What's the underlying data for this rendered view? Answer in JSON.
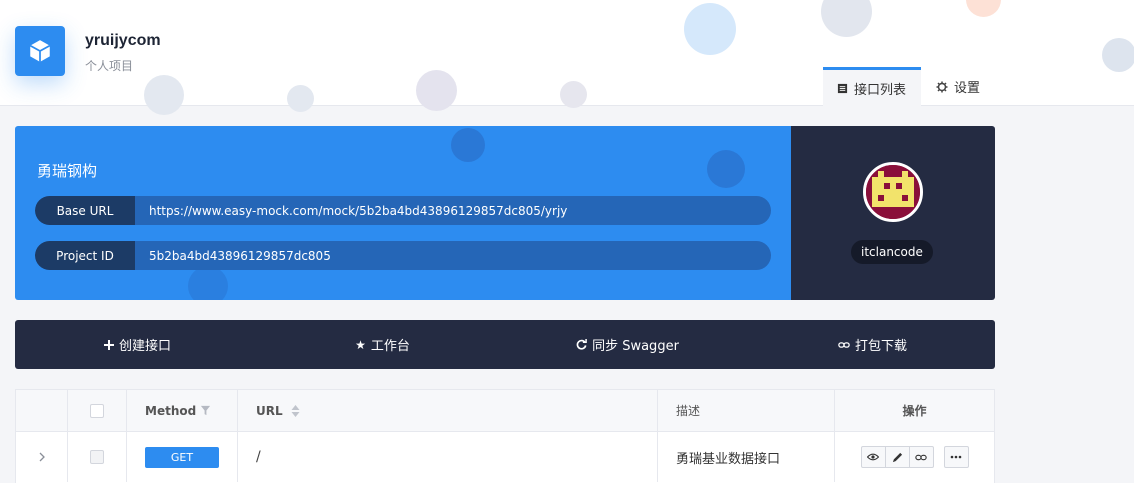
{
  "project": {
    "name": "yruijycom",
    "subtitle": "个人项目",
    "icon": "cube-icon"
  },
  "tabs": [
    {
      "label": "接口列表",
      "icon": "list-icon",
      "active": true
    },
    {
      "label": "设置",
      "icon": "gear-icon",
      "active": false
    }
  ],
  "info": {
    "title": "勇瑞钢构",
    "base_url_label": "Base URL",
    "base_url": "https://www.easy-mock.com/mock/5b2ba4bd43896129857dc805/yrjy",
    "project_id_label": "Project ID",
    "project_id": "5b2ba4bd43896129857dc805"
  },
  "user": {
    "name": "itclancode",
    "avatar_colors": {
      "bg": "#8a0f3a",
      "fg": "#f2e36b"
    }
  },
  "toolbar": [
    {
      "label": "创建接口",
      "icon": "plus-icon"
    },
    {
      "label": "工作台",
      "icon": "star-icon"
    },
    {
      "label": "同步 Swagger",
      "icon": "sync-icon"
    },
    {
      "label": "打包下载",
      "icon": "link-icon"
    }
  ],
  "table": {
    "headers": {
      "method": "Method",
      "url": "URL",
      "desc": "描述",
      "ops": "操作"
    },
    "rows": [
      {
        "method": "GET",
        "url": "/",
        "desc": "勇瑞基业数据接口"
      }
    ]
  },
  "colors": {
    "accent": "#2d8cf0",
    "dark": "#242b42",
    "page_bg": "#f4f5f8"
  }
}
